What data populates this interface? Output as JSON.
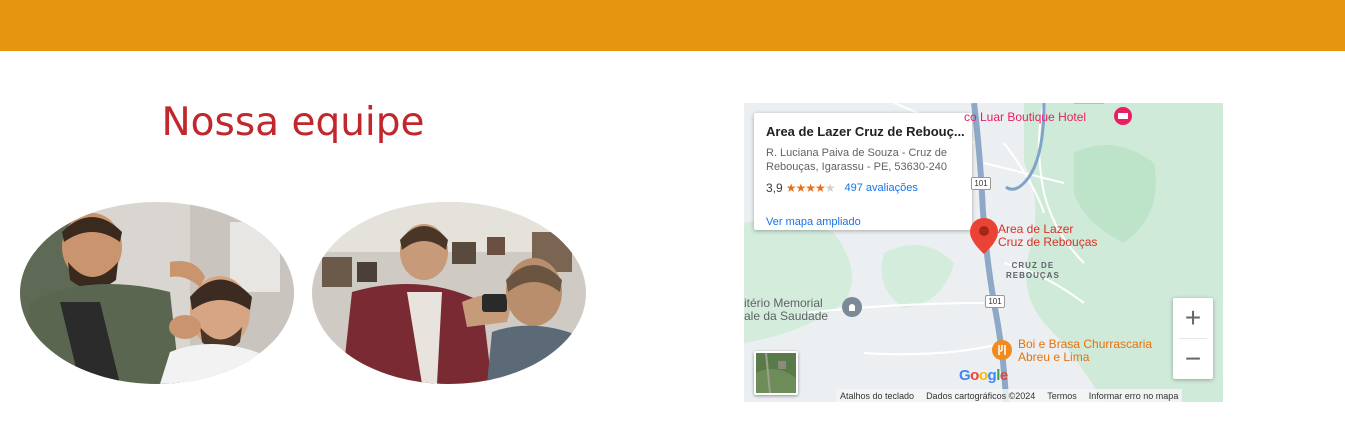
{
  "header": {
    "bar_color": "#E69511"
  },
  "team": {
    "title": "Nossa equipe",
    "title_color": "#C1272D",
    "photos": [
      {
        "name": "barber-photo-1"
      },
      {
        "name": "barber-photo-2"
      }
    ]
  },
  "map": {
    "card": {
      "title": "Area de Lazer Cruz de Rebouç...",
      "address": "R. Luciana Paiva de Souza - Cruz de Rebouças, Igarassu - PE, 53630-240",
      "rating": "3,9",
      "stars_filled": 4,
      "stars_total": 5,
      "reviews": "497 avaliações",
      "larger_map_link": "Ver mapa ampliado"
    },
    "labels": {
      "place_marker": "Area de Lazer\nCruz de Rebouças",
      "district": "CRUZ DE\nREBOUÇAS",
      "hotel": "co Luar Boutique Hotel",
      "cemetery": "itério Memorial\nale da Saudade",
      "restaurant": "Boi e Brasa Churrascaria\nAbreu e Lima",
      "highway_1": "101",
      "highway_2": "101"
    },
    "controls": {
      "zoom_in": "+",
      "zoom_out": "−"
    },
    "google_logo": [
      "G",
      "o",
      "o",
      "g",
      "l",
      "e"
    ],
    "google_colors": [
      "#4285F4",
      "#EA4335",
      "#FBBC05",
      "#4285F4",
      "#34A853",
      "#EA4335"
    ],
    "footer": {
      "shortcuts": "Atalhos do teclado",
      "map_data": "Dados cartográficos ©2024",
      "terms": "Termos",
      "report": "Informar erro no mapa"
    }
  }
}
